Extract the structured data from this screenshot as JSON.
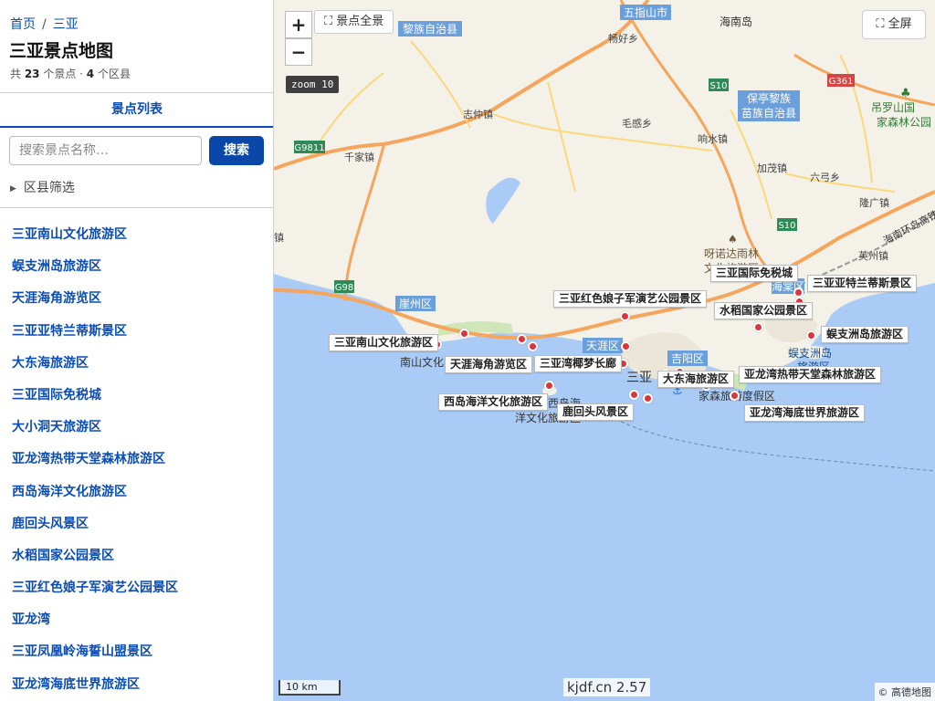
{
  "breadcrumb": {
    "home": "首页",
    "sep": "/",
    "current": "三亚"
  },
  "page_title": "三亚景点地图",
  "stats": {
    "prefix": "共 ",
    "spots": "23",
    "mid": " 个景点 · ",
    "districts": "4",
    "suffix": " 个区县"
  },
  "tab_label": "景点列表",
  "search": {
    "placeholder": "搜索景点名称…",
    "button": "搜索"
  },
  "filter_label": "区县筛选",
  "spots": [
    "三亚南山文化旅游区",
    "蜈支洲岛旅游区",
    "天涯海角游览区",
    "三亚亚特兰蒂斯景区",
    "大东海旅游区",
    "三亚国际免税城",
    "大小洞天旅游区",
    "亚龙湾热带天堂森林旅游区",
    "西岛海洋文化旅游区",
    "鹿回头风景区",
    "水稻国家公园景区",
    "三亚红色娘子军演艺公园景区",
    "亚龙湾",
    "三亚凤凰岭海誓山盟景区",
    "亚龙湾海底世界旅游区"
  ],
  "map": {
    "zoom_in": "+",
    "zoom_out": "−",
    "zoom_label": "zoom 10",
    "overview_button": "⛶ 景点全景",
    "fullscreen_button": "⛶ 全屏",
    "scale_label": "10 km",
    "watermark": "kjdf.cn 2.57",
    "attribution": "© 高德地图",
    "colors": {
      "sea": "#a9cbf5",
      "land": "#f4f1e8",
      "road_main": "#f5a55c",
      "marker": "#d9363e"
    },
    "base_labels": {
      "wuzhishan": "五指山市",
      "ledong": "黎族自治县",
      "baoting_1": "保亭黎族",
      "baoting_2": "苗族自治县",
      "yazhou": "崖州区",
      "tianya": "天涯区",
      "jiyang": "吉阳区",
      "haitang": "海棠区",
      "sanya": "三亚",
      "hainan_island": "海南岛",
      "changfu": "畅好乡",
      "zhicun": "志仲镇",
      "maogan": "毛感乡",
      "xiangshui": "响水镇",
      "qianjia": "千家镇",
      "jiamao": "加茂镇",
      "liugong": "六弓乡",
      "longguang": "隆广镇",
      "yingzhou": "英州镇",
      "diaoluo_1": "吊罗山国",
      "diaoluo_2": "家森林公园",
      "yanuoda_1": "呀诺达雨林",
      "yanuoda_2": "文化旅游区",
      "wuzhizhou_1": "蜈支洲岛",
      "wuzhizhou_2": "旅游区",
      "nanshan": "南山文化",
      "xidao_1": "西岛海",
      "xidao_2": "洋文化旅游区",
      "jiaxing": "家森旅游度假区",
      "road_g9811": "G9811",
      "road_g98": "G98",
      "road_s10a": "S10",
      "road_s10b": "S10",
      "road_g361": "G361",
      "ring_road": "海南环岛高铁",
      "town": "镇"
    },
    "pois": [
      {
        "name": "三亚国际免税城"
      },
      {
        "name": "三亚亚特兰蒂斯景区"
      },
      {
        "name": "三亚红色娘子军演艺公园景区"
      },
      {
        "name": "水稻国家公园景区"
      },
      {
        "name": "蜈支洲岛旅游区"
      },
      {
        "name": "三亚南山文化旅游区"
      },
      {
        "name": "天涯海角游览区"
      },
      {
        "name": "三亚湾椰梦长廊"
      },
      {
        "name": "大东海旅游区"
      },
      {
        "name": "亚龙湾热带天堂森林旅游区"
      },
      {
        "name": "西岛海洋文化旅游区"
      },
      {
        "name": "鹿回头风景区"
      },
      {
        "name": "亚龙湾海底世界旅游区"
      }
    ]
  }
}
